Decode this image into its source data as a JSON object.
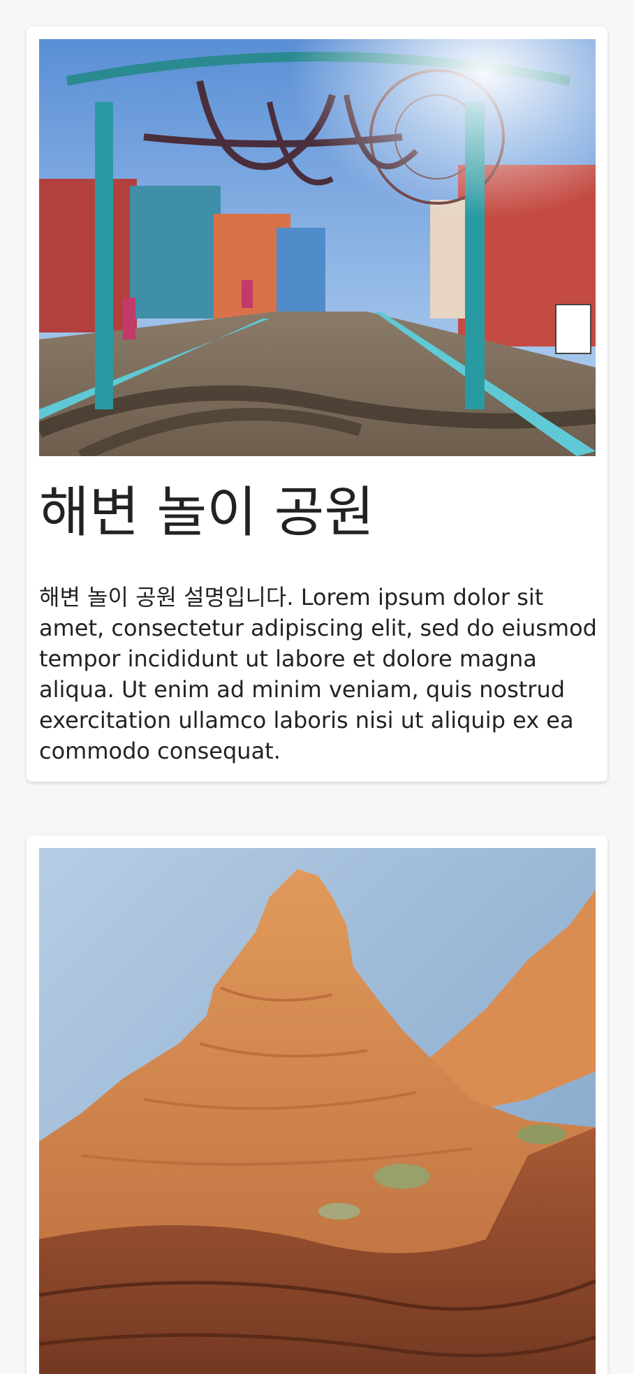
{
  "cards": [
    {
      "image_alt": "pier boardwalk with ferris wheel and arch",
      "title": "해변 놀이 공원",
      "description": "해변 놀이 공원 설명입니다. Lorem ipsum dolor sit amet, consectetur adipiscing elit, sed do eiusmod tempor incididunt ut labore et dolore magna aliqua. Ut enim ad minim veniam, quis nostrud exercitation ullamco laboris nisi ut aliquip ex ea commodo consequat."
    },
    {
      "image_alt": "red sandstone rock formation under blue sky"
    }
  ],
  "colors": {
    "page_background": "#f7f7f7",
    "card_background": "#ffffff",
    "text": "#222222"
  }
}
